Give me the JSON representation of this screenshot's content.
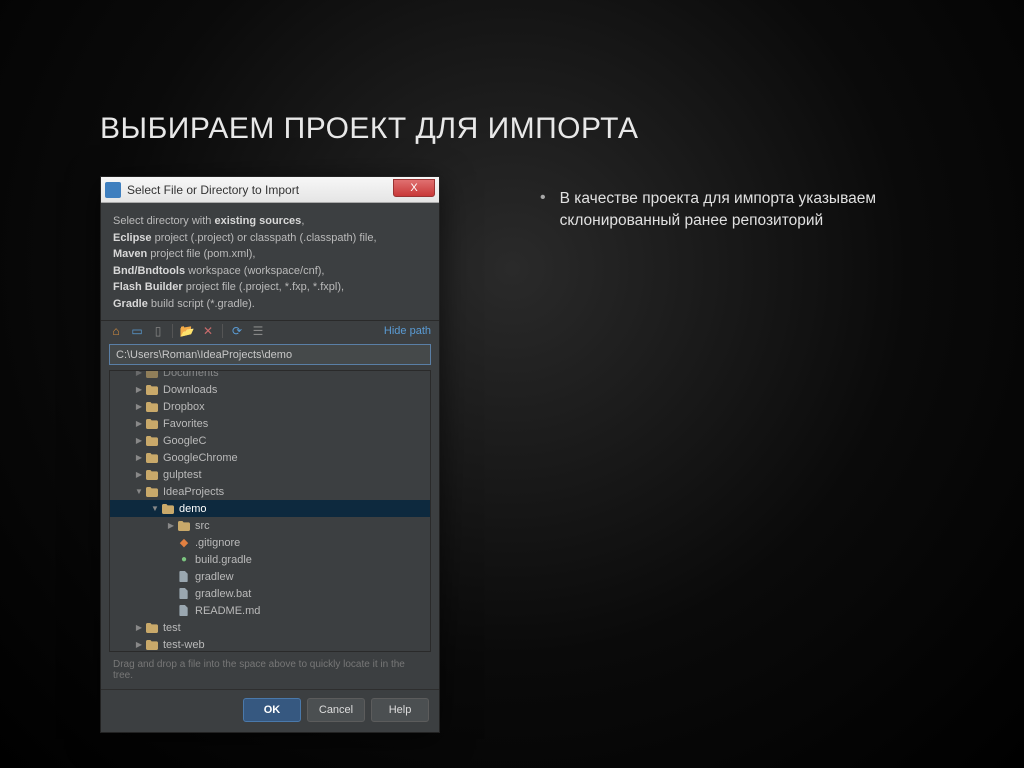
{
  "slide": {
    "title": "ВЫБИРАЕМ ПРОЕКТ ДЛЯ ИМПОРТА",
    "bullet_text": "В качестве проекта для импорта указываем склонированный ранее репозиторий"
  },
  "dialog": {
    "title": "Select File or Directory to Import",
    "close_label": "X",
    "description": {
      "line1_prefix": "Select directory with ",
      "line1_bold": "existing sources",
      "line1_suffix": ",",
      "line2_bold": "Eclipse",
      "line2_rest": " project (.project) or classpath (.classpath) file,",
      "line3_bold": "Maven",
      "line3_rest": " project file (pom.xml),",
      "line4_bold": "Bnd/Bndtools",
      "line4_rest": " workspace (workspace/cnf),",
      "line5_bold": "Flash Builder",
      "line5_rest": " project file (.project, *.fxp, *.fxpl),",
      "line6_bold": "Gradle",
      "line6_rest": " build script (*.gradle)."
    },
    "hide_path": "Hide path",
    "path_value": "C:\\Users\\Roman\\IdeaProjects\\demo",
    "tree": [
      {
        "indent": 1,
        "arrow": "▶",
        "icon": "folder",
        "label": "Documents",
        "cut": true
      },
      {
        "indent": 1,
        "arrow": "▶",
        "icon": "folder",
        "label": "Downloads"
      },
      {
        "indent": 1,
        "arrow": "▶",
        "icon": "folder",
        "label": "Dropbox"
      },
      {
        "indent": 1,
        "arrow": "▶",
        "icon": "folder",
        "label": "Favorites"
      },
      {
        "indent": 1,
        "arrow": "▶",
        "icon": "folder",
        "label": "GoogleC"
      },
      {
        "indent": 1,
        "arrow": "▶",
        "icon": "folder",
        "label": "GoogleChrome"
      },
      {
        "indent": 1,
        "arrow": "▶",
        "icon": "folder",
        "label": "gulptest"
      },
      {
        "indent": 1,
        "arrow": "▼",
        "icon": "folder",
        "label": "IdeaProjects"
      },
      {
        "indent": 2,
        "arrow": "▼",
        "icon": "folder",
        "label": "demo",
        "selected": true
      },
      {
        "indent": 3,
        "arrow": "▶",
        "icon": "folder",
        "label": "src"
      },
      {
        "indent": 3,
        "arrow": "",
        "icon": "git",
        "label": ".gitignore"
      },
      {
        "indent": 3,
        "arrow": "",
        "icon": "gradle",
        "label": "build.gradle"
      },
      {
        "indent": 3,
        "arrow": "",
        "icon": "file",
        "label": "gradlew"
      },
      {
        "indent": 3,
        "arrow": "",
        "icon": "file",
        "label": "gradlew.bat"
      },
      {
        "indent": 3,
        "arrow": "",
        "icon": "file",
        "label": "README.md"
      },
      {
        "indent": 1,
        "arrow": "▶",
        "icon": "folder",
        "label": "test"
      },
      {
        "indent": 1,
        "arrow": "▶",
        "icon": "folder",
        "label": "test-web"
      }
    ],
    "hint": "Drag and drop a file into the space above to quickly locate it in the tree.",
    "buttons": {
      "ok": "OK",
      "cancel": "Cancel",
      "help": "Help"
    }
  },
  "icons": {
    "home": "⌂",
    "module": "▭",
    "cut": "✂",
    "newfolder": "📁",
    "delete": "✕",
    "refresh": "⟳",
    "expand": "☰"
  }
}
